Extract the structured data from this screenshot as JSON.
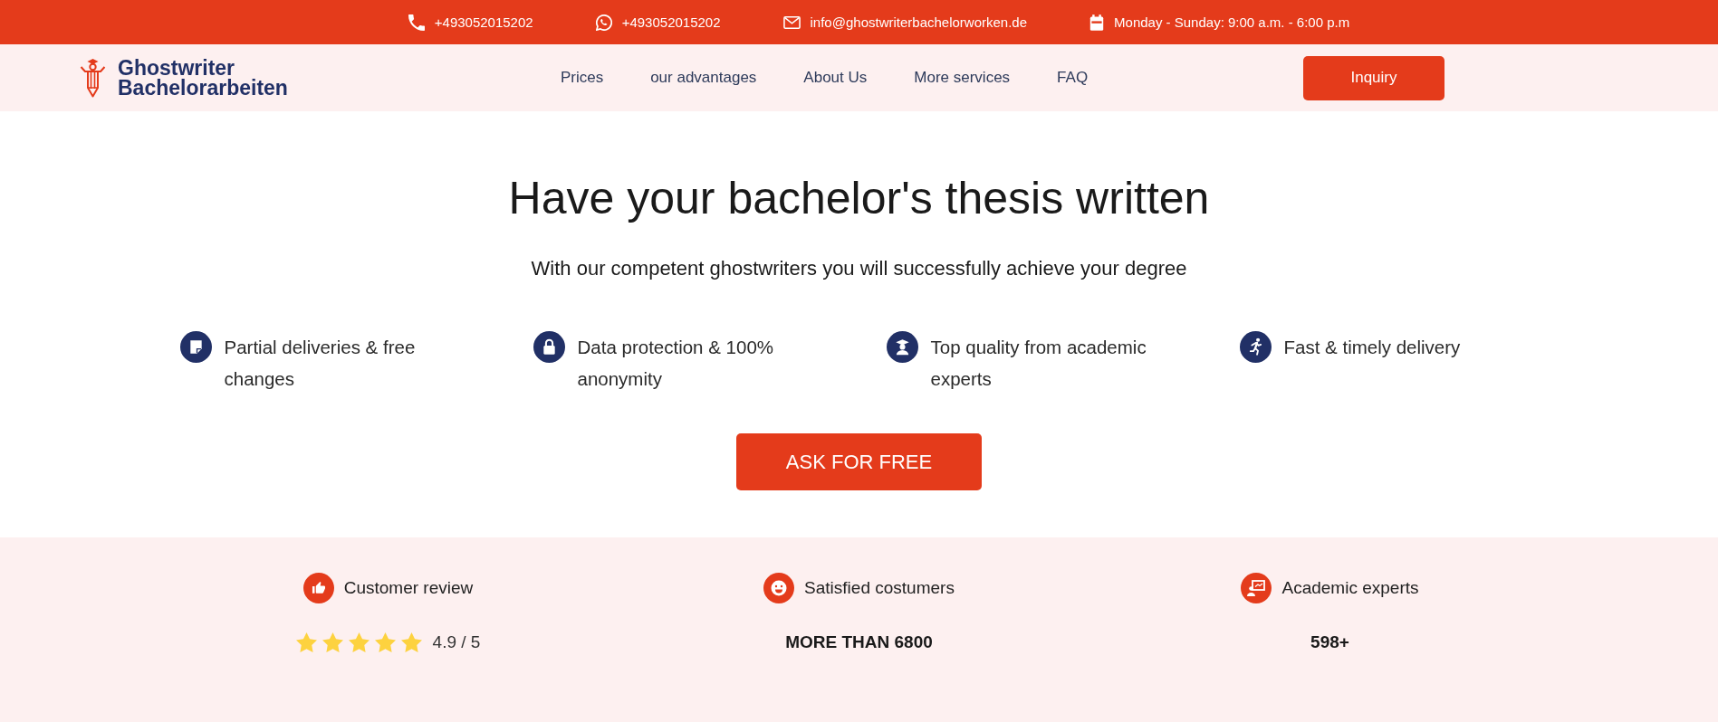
{
  "top_bar": {
    "items": [
      {
        "kind": "phone",
        "text": "+493052015202"
      },
      {
        "kind": "messenger",
        "text": "+493052015202"
      },
      {
        "kind": "email",
        "text": "info@ghostwriterbachelorworken.de"
      },
      {
        "kind": "hours",
        "text": "Monday - Sunday: 9:00 a.m. - 6:00 p.m"
      }
    ]
  },
  "header": {
    "logo": {
      "lines": [
        "Ghostwriter",
        "Bachelorarbeiten"
      ]
    },
    "nav": [
      {
        "label": "Prices"
      },
      {
        "label": "our advantages"
      },
      {
        "label": "About Us"
      },
      {
        "label": "More services"
      },
      {
        "label": "FAQ"
      }
    ],
    "cta": "Inquiry"
  },
  "hero": {
    "title": "Have your bachelor's thesis written",
    "subtitle": "With our competent ghostwriters you will successfully achieve your degree",
    "features": [
      {
        "text": "Partial deliveries & free changes"
      },
      {
        "text": "Data protection & 100% anonymity"
      },
      {
        "text": "Top quality from academic experts"
      },
      {
        "text": "Fast & timely delivery"
      }
    ],
    "button": "ASK FOR FREE"
  },
  "stats": [
    {
      "kind": "rating",
      "label": "Customer review",
      "stars": 5,
      "value": "4.9 / 5"
    },
    {
      "kind": "count",
      "label": "Satisfied costumers",
      "value": "MORE THAN 6800"
    },
    {
      "kind": "count",
      "label": "Academic experts",
      "value": "598+"
    }
  ]
}
